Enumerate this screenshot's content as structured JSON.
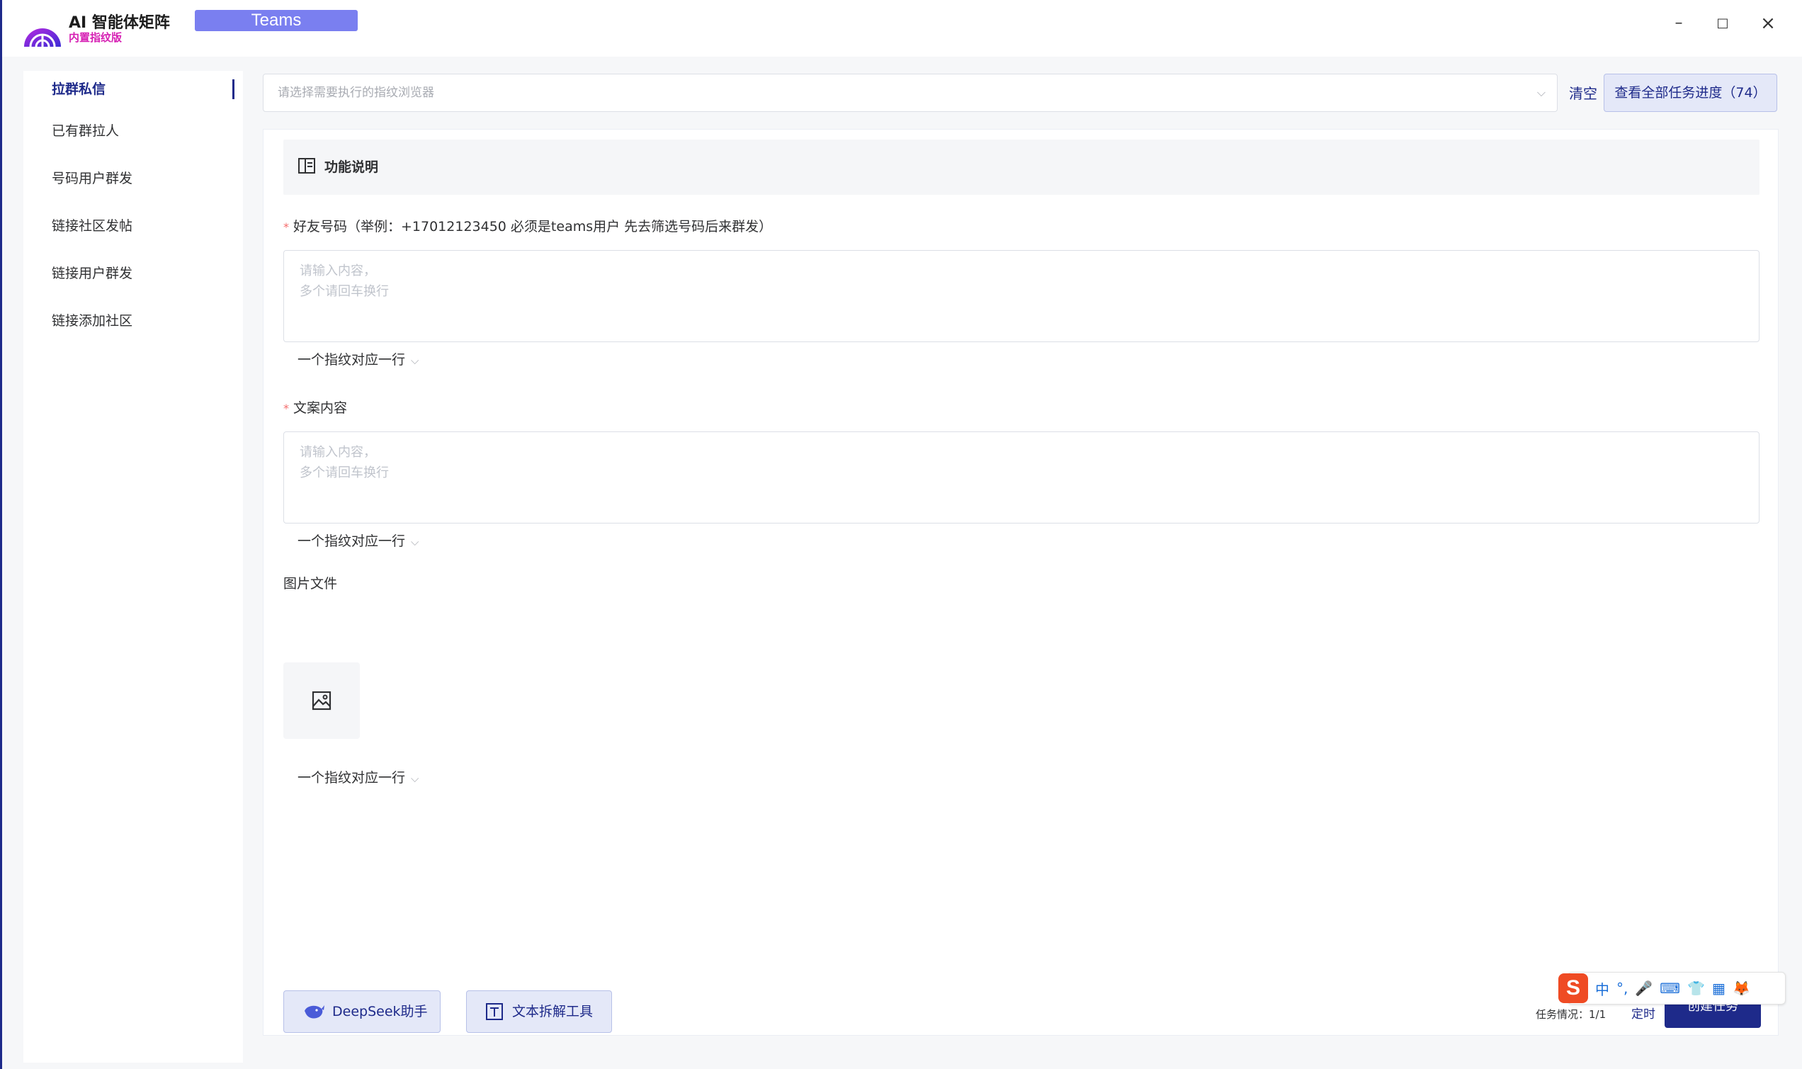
{
  "window": {
    "app_name": "AI 智能体矩阵",
    "app_subtitle": "内置指纹版",
    "tab_label": "Teams",
    "minimize": "–",
    "maximize": "□",
    "close": "×"
  },
  "sidebar": {
    "items": [
      {
        "label": "拉群私信",
        "active": true
      },
      {
        "label": "已有群拉人"
      },
      {
        "label": "号码用户群发"
      },
      {
        "label": "链接社区发帖"
      },
      {
        "label": "链接用户群发"
      },
      {
        "label": "链接添加社区"
      }
    ]
  },
  "toolbar": {
    "browser_select_placeholder": "请选择需要执行的指纹浏览器",
    "clear_label": "清空",
    "progress_button": "查看全部任务进度（74）"
  },
  "form": {
    "func_title": "功能说明",
    "friend_label": "好友号码（举例：+17012123450 必须是teams用户 先去筛选号码后来群发）",
    "friend_placeholder": "请输入内容，\n多个请回车换行",
    "friend_hint": "一个指纹对应一行",
    "copy_label": "文案内容",
    "copy_placeholder": "请输入内容，\n多个请回车换行",
    "copy_hint": "一个指纹对应一行",
    "image_label": "图片文件",
    "image_hint": "一个指纹对应一行"
  },
  "footer": {
    "deepseek_button": "DeepSeek助手",
    "split_button": "文本拆解工具",
    "task_status": "任务情况：1/1",
    "timer_label": "定时",
    "create_button": "创建任务"
  },
  "ime": {
    "logo": "S",
    "items": [
      "中",
      "°,",
      "🎤",
      "⌨",
      "👕",
      "▦",
      "🦊"
    ]
  },
  "colors": {
    "accent": "#1e2a8a",
    "tab_bg": "#7a7ff0",
    "subtitle": "#d61fb3",
    "required": "#f56c6c"
  }
}
